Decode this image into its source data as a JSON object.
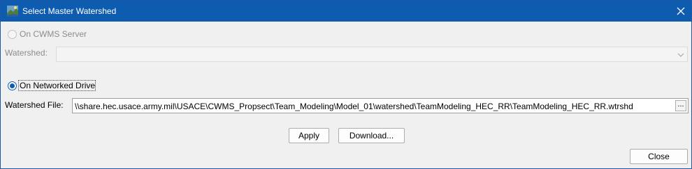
{
  "window": {
    "title": "Select Master Watershed",
    "app_icon": "hec-watershed-app-icon",
    "close_icon": "close-icon"
  },
  "source_options": {
    "cwms_server": {
      "label": "On CWMS Server",
      "selected": false,
      "enabled": false
    },
    "networked_drive": {
      "label": "On Networked Drive",
      "selected": true,
      "enabled": true
    }
  },
  "watershed": {
    "label": "Watershed:",
    "value": ""
  },
  "watershed_file": {
    "label": "Watershed File:",
    "value": "\\\\share.hec.usace.army.mil\\USACE\\CWMS_Propsect\\Team_Modeling\\Model_01\\watershed\\TeamModeling_HEC_RR\\TeamModeling_HEC_RR.wtrshd",
    "browse_label": "..."
  },
  "buttons": {
    "apply": "Apply",
    "download": "Download...",
    "close": "Close"
  },
  "colors": {
    "titlebar": "#0e5cb0",
    "accent": "#0e5cb0"
  }
}
